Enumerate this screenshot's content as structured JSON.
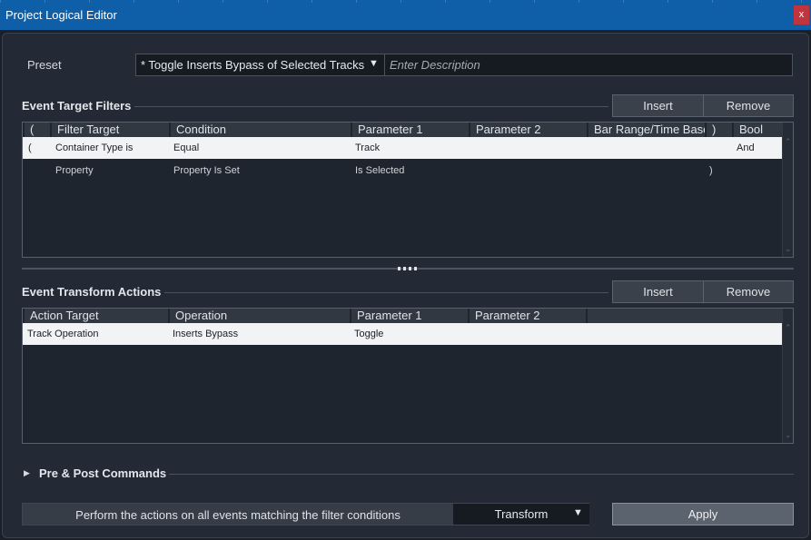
{
  "window": {
    "title": "Project Logical Editor",
    "close_label": "x"
  },
  "preset": {
    "label": "Preset",
    "value": "* Toggle Inserts Bypass of Selected Tracks",
    "arrow": "▼",
    "description_placeholder": "Enter Description",
    "description_value": ""
  },
  "filters": {
    "title": "Event Target Filters",
    "insert_label": "Insert",
    "remove_label": "Remove",
    "columns": [
      "(",
      "Filter Target",
      "Condition",
      "Parameter 1",
      "Parameter 2",
      "Bar Range/Time Base",
      ")",
      "Bool"
    ],
    "rows": [
      {
        "open": "(",
        "target": "Container Type is",
        "condition": "Equal",
        "param1": "Track",
        "param2": "",
        "bar_range": "",
        "close": "",
        "bool": "And",
        "selected": true
      },
      {
        "open": "",
        "target": "Property",
        "condition": "Property Is Set",
        "param1": "Is Selected",
        "param2": "",
        "bar_range": "",
        "close": ")",
        "bool": "",
        "selected": false
      }
    ]
  },
  "actions": {
    "title": "Event Transform Actions",
    "insert_label": "Insert",
    "remove_label": "Remove",
    "columns": [
      "Action Target",
      "Operation",
      "Parameter 1",
      "Parameter 2"
    ],
    "rows": [
      {
        "target": "Track Operation",
        "operation": "Inserts Bypass",
        "param1": "Toggle",
        "param2": "",
        "selected": true
      }
    ]
  },
  "pre_post": {
    "label": "Pre & Post Commands",
    "expand_icon": "▶"
  },
  "footer": {
    "perform_text": "Perform the actions on all events matching the filter conditions",
    "mode_value": "Transform",
    "mode_arrow": "▼",
    "apply_label": "Apply"
  },
  "colors": {
    "titlebar": "#0f5ea8",
    "close": "#c0343d",
    "selected_row": "#f2f3f5",
    "panel": "#232a35"
  }
}
